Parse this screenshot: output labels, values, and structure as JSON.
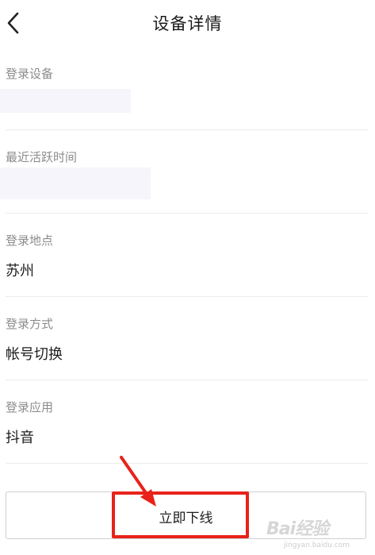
{
  "header": {
    "title": "设备详情",
    "back_icon": "chevron-left-icon"
  },
  "sections": [
    {
      "label": "登录设备",
      "value": ""
    },
    {
      "label": "最近活跃时间",
      "value": ""
    },
    {
      "label": "登录地点",
      "value": "苏州"
    },
    {
      "label": "登录方式",
      "value": "帐号切换"
    },
    {
      "label": "登录应用",
      "value": "抖音"
    }
  ],
  "action": {
    "label": "立即下线"
  },
  "annotation": {
    "highlight_color": "#e8221a"
  },
  "watermark": {
    "text": "Bai经验",
    "sub": "jingyan.baidu.com"
  }
}
